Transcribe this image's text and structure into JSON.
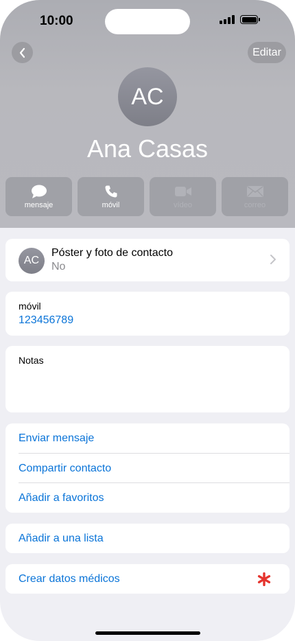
{
  "status_bar": {
    "time": "10:00"
  },
  "nav": {
    "edit_label": "Editar"
  },
  "contact": {
    "initials": "AC",
    "name": "Ana Casas"
  },
  "actions": [
    {
      "label": "mensaje",
      "icon": "message-bubble-icon",
      "enabled": true
    },
    {
      "label": "móvil",
      "icon": "phone-icon",
      "enabled": true
    },
    {
      "label": "vídeo",
      "icon": "video-camera-icon",
      "enabled": false
    },
    {
      "label": "correo",
      "icon": "envelope-icon",
      "enabled": false
    }
  ],
  "poster": {
    "title": "Póster y foto de contacto",
    "value": "No",
    "initials": "AC"
  },
  "phone_field": {
    "label": "móvil",
    "number": "123456789"
  },
  "notes": {
    "label": "Notas"
  },
  "links": {
    "send_message": "Enviar mensaje",
    "share_contact": "Compartir contacto",
    "add_favorites": "Añadir a favoritos",
    "add_to_list": "Añadir a una lista",
    "create_medical": "Crear datos médicos"
  },
  "colors": {
    "link": "#0a74d8",
    "asterisk": "#e5342e",
    "header_bg": "#b8b8bd"
  }
}
